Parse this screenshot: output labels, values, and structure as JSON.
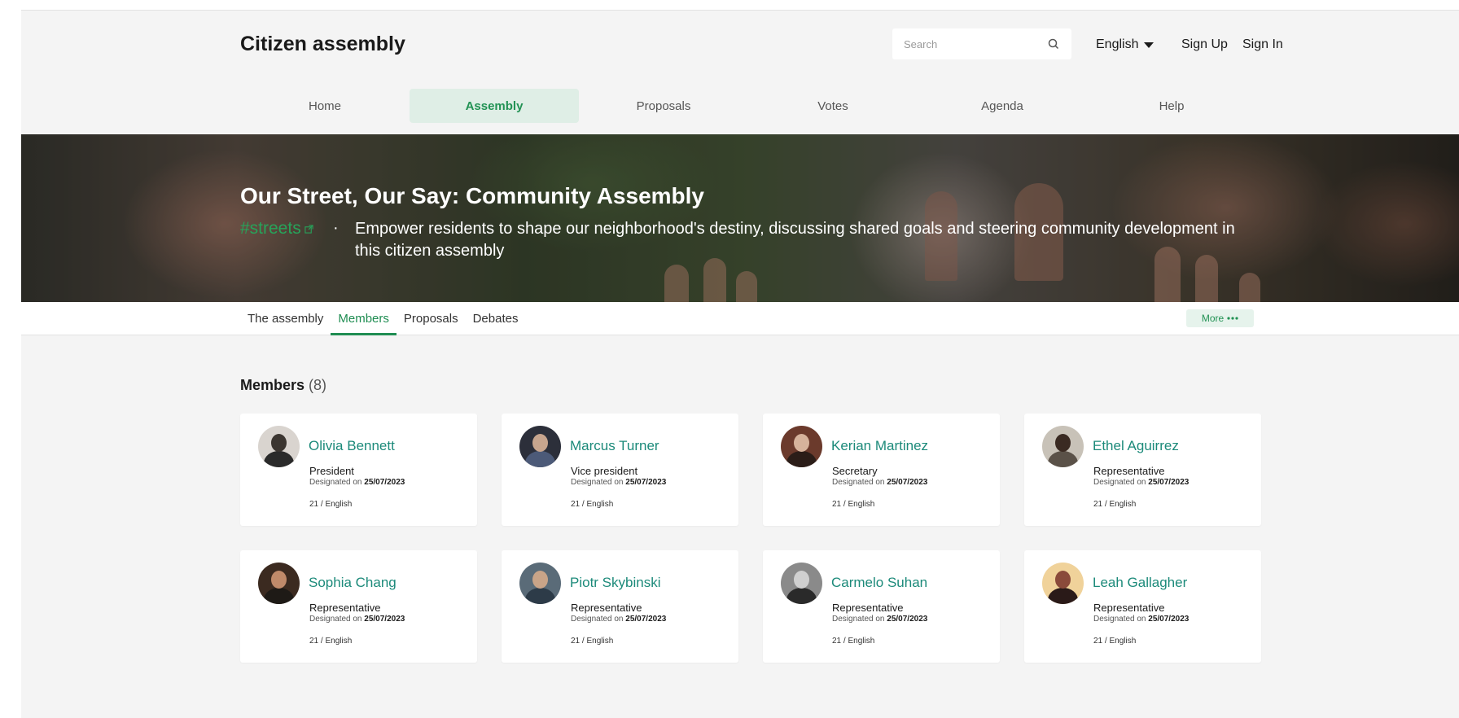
{
  "header": {
    "site_title": "Citizen assembly",
    "search_placeholder": "Search",
    "language": "English",
    "sign_up": "Sign Up",
    "sign_in": "Sign In"
  },
  "main_nav": [
    "Home",
    "Assembly",
    "Proposals",
    "Votes",
    "Agenda",
    "Help"
  ],
  "main_nav_active": "Assembly",
  "hero": {
    "title": "Our Street, Our Say: Community Assembly",
    "hashtag": "#streets",
    "separator": "·",
    "description": "Empower residents to shape our neighborhood's destiny, discussing shared goals and steering community development in this citizen assembly"
  },
  "sub_tabs": [
    "The assembly",
    "Members",
    "Proposals",
    "Debates"
  ],
  "sub_tab_active": "Members",
  "more_button": "More",
  "members_section": {
    "heading": "Members",
    "count": "(8)",
    "designated_label": "Designated on",
    "members": [
      {
        "name": "Olivia Bennett",
        "role": "President",
        "date": "25/07/2023",
        "meta": "21 / English"
      },
      {
        "name": "Marcus Turner",
        "role": "Vice president",
        "date": "25/07/2023",
        "meta": "21 / English"
      },
      {
        "name": "Kerian Martinez",
        "role": "Secretary",
        "date": "25/07/2023",
        "meta": "21 / English"
      },
      {
        "name": "Ethel Aguirrez",
        "role": "Representative",
        "date": "25/07/2023",
        "meta": "21 / English"
      },
      {
        "name": "Sophia Chang",
        "role": "Representative",
        "date": "25/07/2023",
        "meta": "21 / English"
      },
      {
        "name": "Piotr Skybinski",
        "role": "Representative",
        "date": "25/07/2023",
        "meta": "21 / English"
      },
      {
        "name": "Carmelo Suhan",
        "role": "Representative",
        "date": "25/07/2023",
        "meta": "21 / English"
      },
      {
        "name": "Leah Gallagher",
        "role": "Representative",
        "date": "25/07/2023",
        "meta": "21 / English"
      }
    ]
  },
  "colors": {
    "accent_green": "#229254",
    "active_tab_bg": "#dfeee6",
    "member_name": "#1c8a7a",
    "page_bg": "#f4f4f4"
  }
}
